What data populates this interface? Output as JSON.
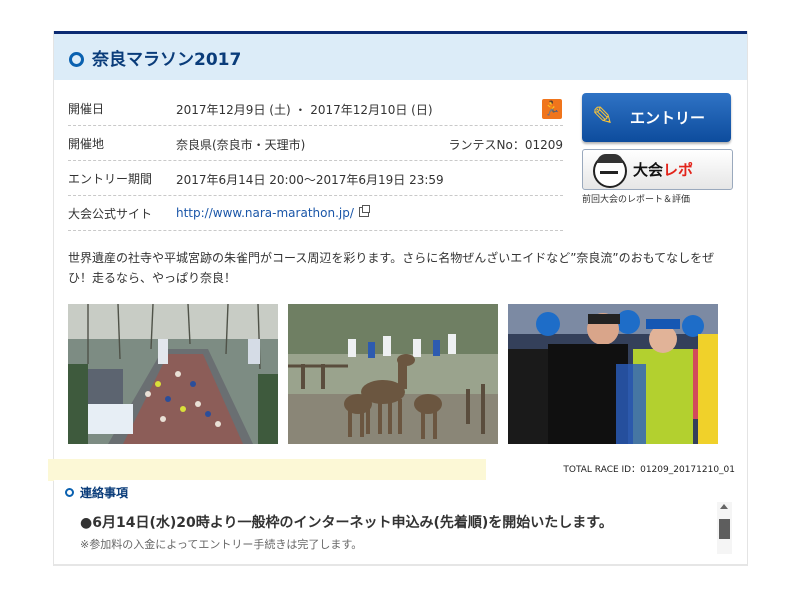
{
  "header": {
    "title": "奈良マラソン2017"
  },
  "info": {
    "date_label": "開催日",
    "date_value": "2017年12月9日 (土) ・ 2017年12月10日 (日)",
    "place_label": "開催地",
    "place_value": "奈良県(奈良市・天理市)",
    "runtes_no": "ランテスNo：01209",
    "entry_label": "エントリー期間",
    "entry_value": "2017年6月14日 20:00〜2017年6月19日 23:59",
    "site_label": "大会公式サイト",
    "site_value": "http://www.nara-marathon.jp/"
  },
  "buttons": {
    "entry_label": "エントリー",
    "report_label_1": "大会",
    "report_label_2": "レポ",
    "report_caption": "前回大会のレポート＆評価"
  },
  "description": "世界遺産の社寺や平城宮跡の朱雀門がコース周辺を彩ります。さらに名物ぜんざいエイドなど”奈良流”のおもてなしをぜひ！走るなら、やっぱり奈良！",
  "total_race_id": "TOTAL RACE ID：01209_20171210_01",
  "notice": {
    "title": "連絡事項",
    "message": "●6月14日(水)20時より一般枠のインターネット申込み(先着順)を開始いたします。",
    "sub": "※参加料の入金によってエントリー手続きは完了します。"
  },
  "colors": {
    "brand": "#0a3c7a",
    "header_bg": "#dcecf8",
    "entry_button": "#1559ad",
    "runner_icon": "#f0751c"
  },
  "icons": [
    "runner-icon",
    "external-link-icon",
    "pencil-icon",
    "mascot-icon",
    "ring-icon",
    "scroll-up-icon"
  ]
}
